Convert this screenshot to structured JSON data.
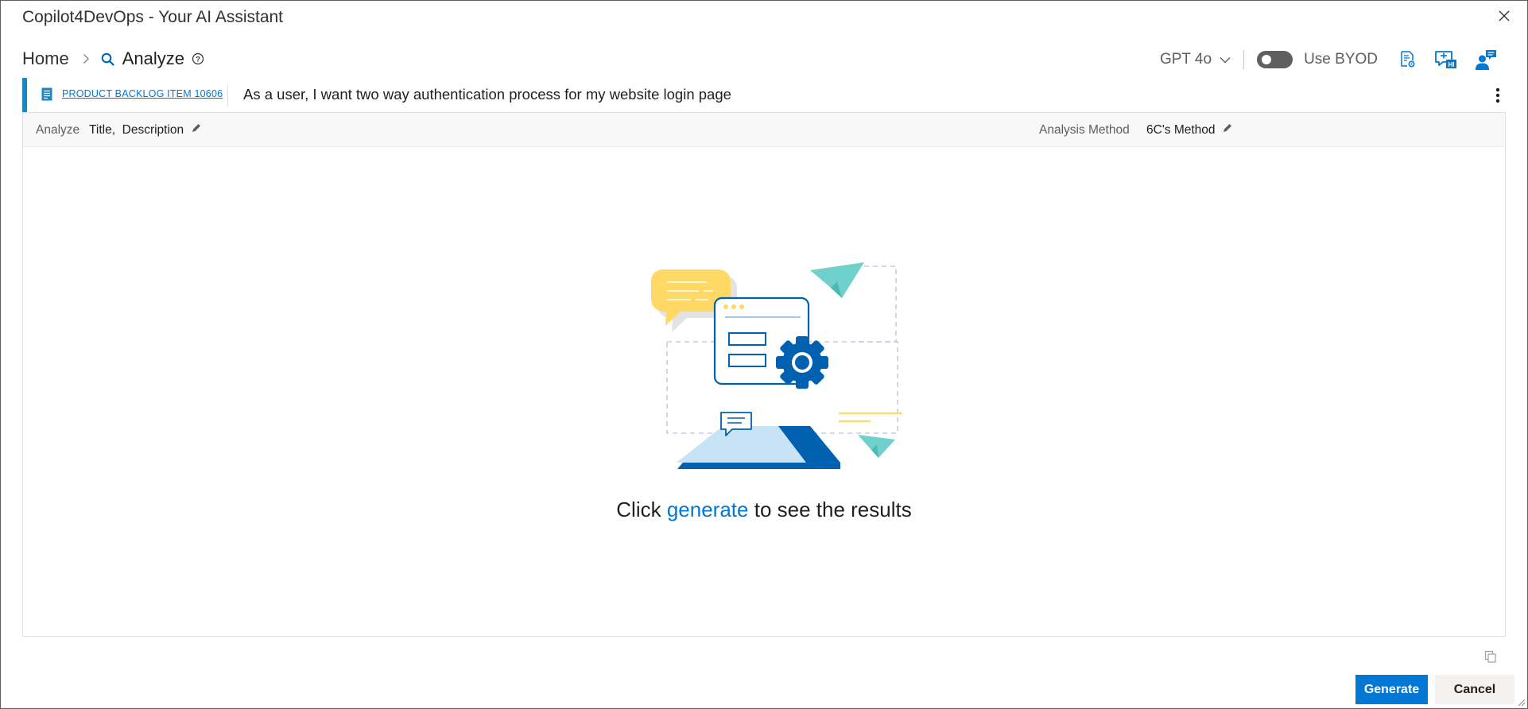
{
  "window": {
    "title": "Copilot4DevOps - Your AI Assistant"
  },
  "breadcrumb": {
    "home": "Home",
    "current": "Analyze"
  },
  "header": {
    "model": "GPT 4o",
    "byod_label": "Use BYOD",
    "byod_enabled": false
  },
  "work_item": {
    "link": "PRODUCT BACKLOG ITEM 10606",
    "title": "As a user, I want two way authentication process for my website login page"
  },
  "analysis": {
    "analyze_label": "Analyze",
    "analyze_fields": "Title,  Description",
    "method_label": "Analysis Method",
    "method_value": "6C's Method"
  },
  "empty_state": {
    "prefix": "Click",
    "link": "generate",
    "suffix": "to see the results"
  },
  "footer": {
    "generate": "Generate",
    "cancel": "Cancel"
  },
  "colors": {
    "accent": "#0078d4",
    "bar": "#1a86c8",
    "illustration_blue": "#0061b0",
    "illustration_yellow": "#ffd866",
    "illustration_teal": "#6fd0cc"
  },
  "icons": [
    "close-icon",
    "chevron-right-icon",
    "search-icon",
    "help-icon",
    "chevron-down-icon",
    "settings-doc-icon",
    "chat-hi-icon",
    "user-chat-icon",
    "work-item-icon",
    "more-vertical-icon",
    "pencil-icon",
    "copy-icon",
    "resize-grip-icon"
  ]
}
